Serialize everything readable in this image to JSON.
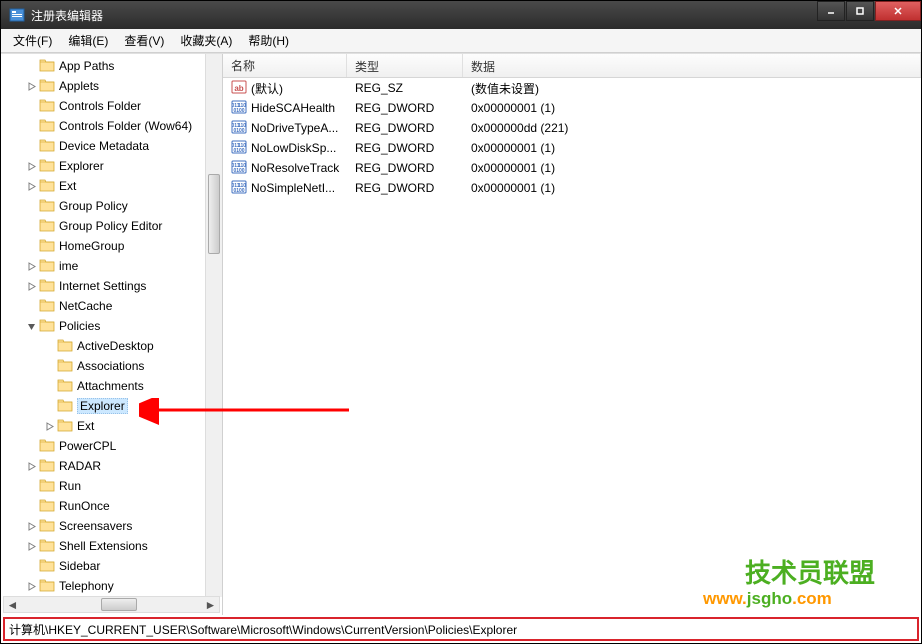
{
  "window": {
    "title": "注册表编辑器"
  },
  "menu": {
    "items": [
      "文件(F)",
      "编辑(E)",
      "查看(V)",
      "收藏夹(A)",
      "帮助(H)"
    ]
  },
  "tree": {
    "nodes": [
      {
        "label": "App Paths",
        "indent": 0,
        "exp": null
      },
      {
        "label": "Applets",
        "indent": 0,
        "exp": "closed"
      },
      {
        "label": "Controls Folder",
        "indent": 0,
        "exp": null
      },
      {
        "label": "Controls Folder (Wow64)",
        "indent": 0,
        "exp": null
      },
      {
        "label": "Device Metadata",
        "indent": 0,
        "exp": null
      },
      {
        "label": "Explorer",
        "indent": 0,
        "exp": "closed"
      },
      {
        "label": "Ext",
        "indent": 0,
        "exp": "closed"
      },
      {
        "label": "Group Policy",
        "indent": 0,
        "exp": null
      },
      {
        "label": "Group Policy Editor",
        "indent": 0,
        "exp": null
      },
      {
        "label": "HomeGroup",
        "indent": 0,
        "exp": null
      },
      {
        "label": "ime",
        "indent": 0,
        "exp": "closed"
      },
      {
        "label": "Internet Settings",
        "indent": 0,
        "exp": "closed"
      },
      {
        "label": "NetCache",
        "indent": 0,
        "exp": null
      },
      {
        "label": "Policies",
        "indent": 0,
        "exp": "open"
      },
      {
        "label": "ActiveDesktop",
        "indent": 1,
        "exp": null
      },
      {
        "label": "Associations",
        "indent": 1,
        "exp": null
      },
      {
        "label": "Attachments",
        "indent": 1,
        "exp": null
      },
      {
        "label": "Explorer",
        "indent": 1,
        "exp": null,
        "selected": true
      },
      {
        "label": "Ext",
        "indent": 1,
        "exp": "closed"
      },
      {
        "label": "PowerCPL",
        "indent": 0,
        "exp": null
      },
      {
        "label": "RADAR",
        "indent": 0,
        "exp": "closed"
      },
      {
        "label": "Run",
        "indent": 0,
        "exp": null
      },
      {
        "label": "RunOnce",
        "indent": 0,
        "exp": null
      },
      {
        "label": "Screensavers",
        "indent": 0,
        "exp": "closed"
      },
      {
        "label": "Shell Extensions",
        "indent": 0,
        "exp": "closed"
      },
      {
        "label": "Sidebar",
        "indent": 0,
        "exp": null
      },
      {
        "label": "Telephony",
        "indent": 0,
        "exp": "closed"
      }
    ]
  },
  "list": {
    "headers": {
      "name": "名称",
      "type": "类型",
      "data": "数据"
    },
    "rows": [
      {
        "icon": "string",
        "name": "(默认)",
        "type": "REG_SZ",
        "data": "(数值未设置)"
      },
      {
        "icon": "dword",
        "name": "HideSCAHealth",
        "type": "REG_DWORD",
        "data": "0x00000001 (1)"
      },
      {
        "icon": "dword",
        "name": "NoDriveTypeA...",
        "type": "REG_DWORD",
        "data": "0x000000dd (221)"
      },
      {
        "icon": "dword",
        "name": "NoLowDiskSp...",
        "type": "REG_DWORD",
        "data": "0x00000001 (1)"
      },
      {
        "icon": "dword",
        "name": "NoResolveTrack",
        "type": "REG_DWORD",
        "data": "0x00000001 (1)"
      },
      {
        "icon": "dword",
        "name": "NoSimpleNetI...",
        "type": "REG_DWORD",
        "data": "0x00000001 (1)"
      }
    ]
  },
  "statusbar": {
    "path": "计算机\\HKEY_CURRENT_USER\\Software\\Microsoft\\Windows\\CurrentVersion\\Policies\\Explorer"
  },
  "watermark": {
    "line1": "技术员联盟",
    "line2": "www.jsgho.com"
  }
}
